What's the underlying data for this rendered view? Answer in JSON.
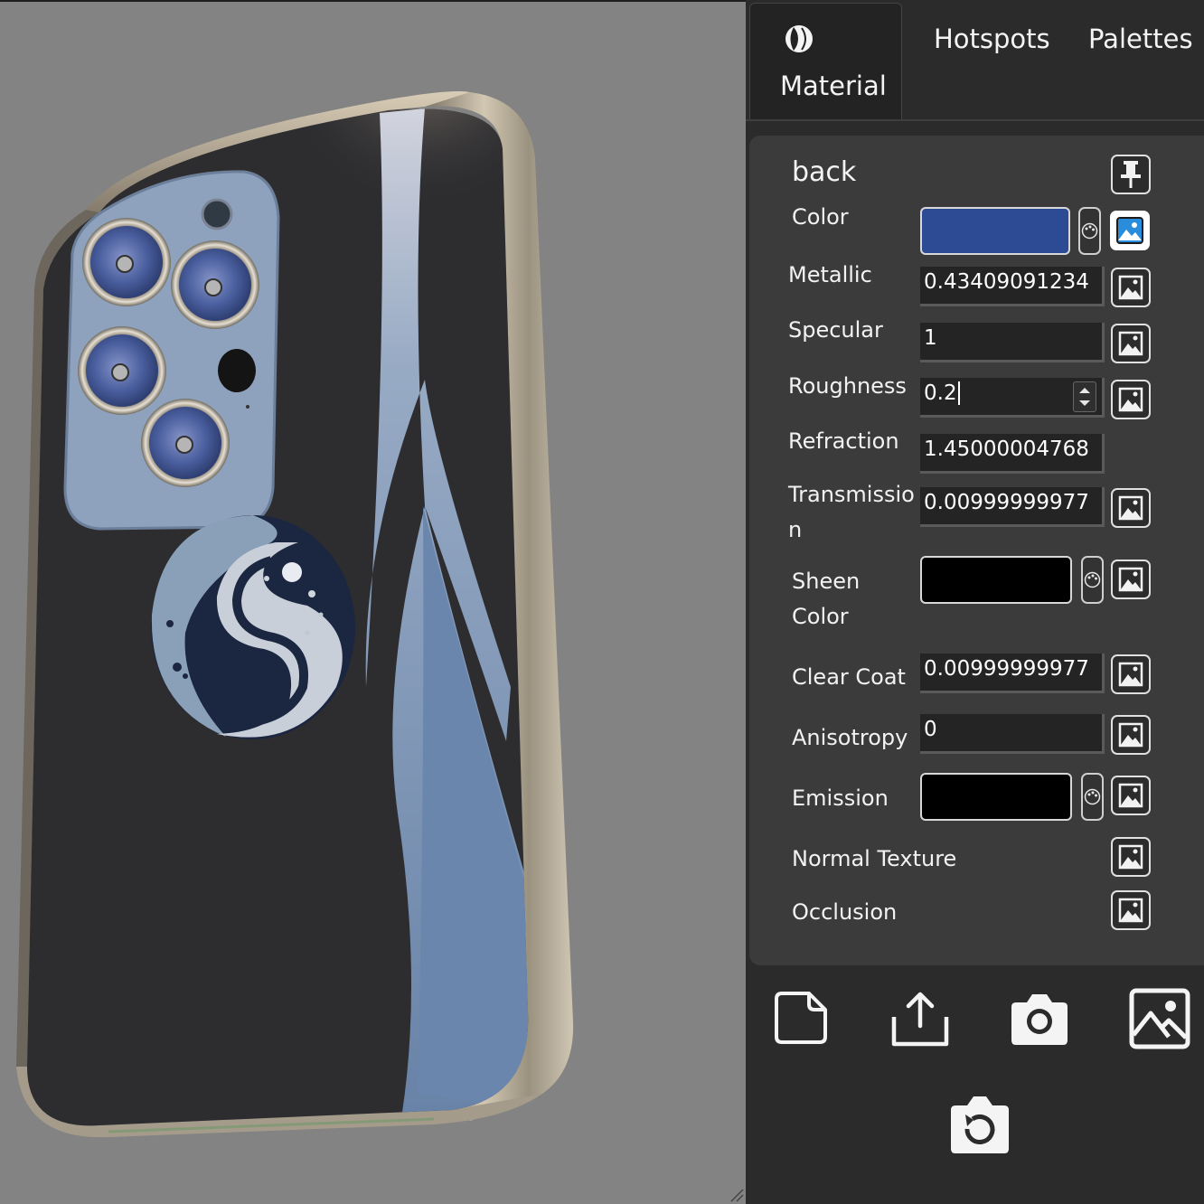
{
  "tabs": [
    {
      "label": "Material",
      "icon": "material-sphere-icon",
      "active": true
    },
    {
      "label": "Hotspots",
      "active": false
    },
    {
      "label": "Palettes",
      "active": false
    }
  ],
  "material": {
    "name": "back",
    "properties": {
      "color": {
        "label": "Color",
        "value": "#2d4b94"
      },
      "metallic": {
        "label": "Metallic",
        "value": "0.43409091234"
      },
      "specular": {
        "label": "Specular",
        "value": "1"
      },
      "roughness": {
        "label": "Roughness",
        "value": "0.2"
      },
      "refraction": {
        "label": "Refraction",
        "value": "1.45000004768"
      },
      "transmission": {
        "label_line1": "Transmissio",
        "label_line2": "n",
        "value": "0.00999999977"
      },
      "sheen_color": {
        "label_line1": "Sheen",
        "label_line2": "Color",
        "value": "#000000"
      },
      "clear_coat": {
        "label": "Clear Coat",
        "value": "0.00999999977"
      },
      "anisotropy": {
        "label": "Anisotropy",
        "value": "0"
      },
      "emission": {
        "label": "Emission",
        "value": "#000000"
      },
      "normal_texture": {
        "label": "Normal Texture"
      },
      "occlusion": {
        "label": "Occlusion"
      }
    }
  },
  "toolbar": {
    "icons": [
      "new-document-icon",
      "share-upload-icon",
      "camera-icon",
      "image-icon",
      "reset-camera-icon"
    ]
  },
  "colors": {
    "panel_bg": "#2b2b2b",
    "card_bg": "#3b3b3b",
    "viewport_bg": "#838383"
  }
}
